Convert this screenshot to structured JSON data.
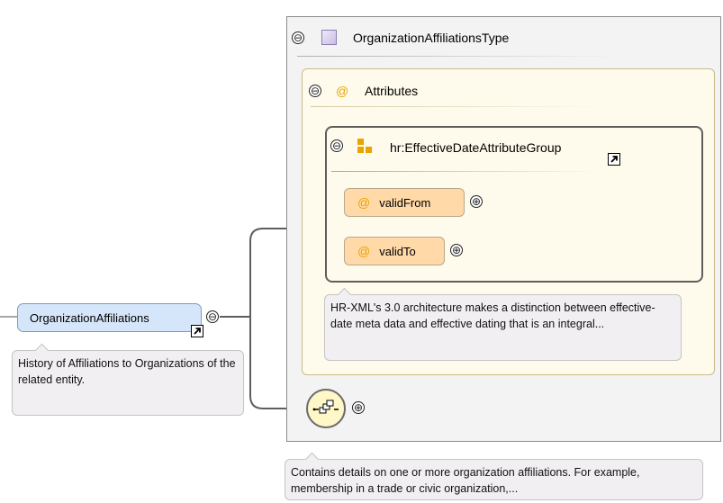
{
  "complex_type": {
    "name": "OrganizationAffiliationsType",
    "documentation": "Contains details on one or more organization affiliations. For example, membership in a trade or civic organization,..."
  },
  "attributes": {
    "label": "Attributes",
    "icon": "at-sign-icon",
    "group": {
      "name": "hr:EffectiveDateAttributeGroup",
      "icon": "attribute-group-icon",
      "documentation": "HR-XML's 3.0 architecture makes a distinction between effective-date meta data and effective dating that is an integral...",
      "items": [
        {
          "name": "validFrom",
          "icon": "at-sign-icon"
        },
        {
          "name": "validTo",
          "icon": "at-sign-icon"
        }
      ]
    }
  },
  "root_element": {
    "name": "OrganizationAffiliations",
    "documentation": "History of Affiliations to Organizations of the related entity."
  },
  "compositor": {
    "type": "sequence",
    "icon": "sequence-icon"
  },
  "glyphs": {
    "at": "@",
    "collapse": "⊖",
    "expand": "⊕"
  },
  "colors": {
    "element_fill": "#d6e6fa",
    "attribute_fill": "#ffd9a8",
    "attributes_background": "#fffbec",
    "type_background": "#f3f3f3",
    "doc_background": "#f1eff1",
    "connector": "#5e5e5e"
  }
}
